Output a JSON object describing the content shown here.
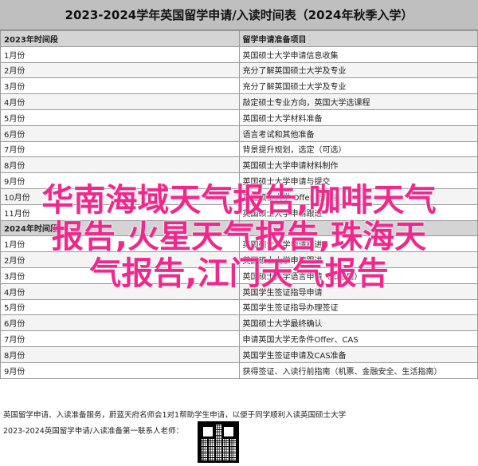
{
  "document": {
    "title": "2023-2024学年英国留学申请/入读时间表（2024年秋季入学）",
    "headers": {
      "period": "2023年时间段",
      "content": "留学申请准备项目"
    },
    "rows": [
      {
        "period": "1月份",
        "content": "英国硕士大学申请信息收集"
      },
      {
        "period": "2月份",
        "content": "充分了解英国硕士大学及专业"
      },
      {
        "period": "3月份",
        "content": "充分了解英国硕士大学及专业"
      },
      {
        "period": "4月份",
        "content": "敲定硕士专业方向，英国大学选课程"
      },
      {
        "period": "5月份",
        "content": "英国硕士大学材料准备"
      },
      {
        "period": "6月份",
        "content": "语言考试和其他准备"
      },
      {
        "period": "7月份",
        "content": "背景提升规划，选定（可选）"
      },
      {
        "period": "8月份",
        "content": "英国硕士大学申请材料制作"
      },
      {
        "period": "9月份",
        "content": "英国硕士大学申请与提交"
      },
      {
        "period": "10月份",
        "content": "英国硕士大学 Offer 与后续"
      },
      {
        "period": "11月份",
        "content": "英国硕士大学申请跟进"
      },
      {
        "period": "2024年时间段",
        "content": ""
      },
      {
        "period": "1月份",
        "content": "英国硕士大学申请跟进"
      },
      {
        "period": "2月份",
        "content": "英国硕士大学申请跟进"
      },
      {
        "period": "3月份",
        "content": "英国硕士大学语言申请（如适用）"
      },
      {
        "period": "4月份",
        "content": "英国学生签证指导申请"
      },
      {
        "period": "5月份",
        "content": "英国学生签证指导办理签证"
      },
      {
        "period": "6月份",
        "content": "英国硕士大学最终确认"
      },
      {
        "period": "7月份",
        "content": "申请英国大学无条件Offer、CAS"
      },
      {
        "period": "8月份",
        "content": "英国学生签证申请及CAS准备"
      },
      {
        "period": "9月份",
        "content": "获得签证、入读行前指南（机票、金融安全、生活指南）"
      }
    ],
    "footer_note": "英国留学申请、入读准备服务，蔚蓝天府名师会1对1帮助学生申请，以便于同学顺利入读英国硕士大学",
    "footer_contact": "2023-2024英国留学申请/入读准备第一联系人老师：",
    "qr_icon": "qr-code-icon"
  },
  "overlay": {
    "line1": "华南海域天气报告,咖啡天气",
    "line2": "报告,火星天气报告,珠海天",
    "line3": "气报告,江门天气报告",
    "color": "#f0288c"
  }
}
